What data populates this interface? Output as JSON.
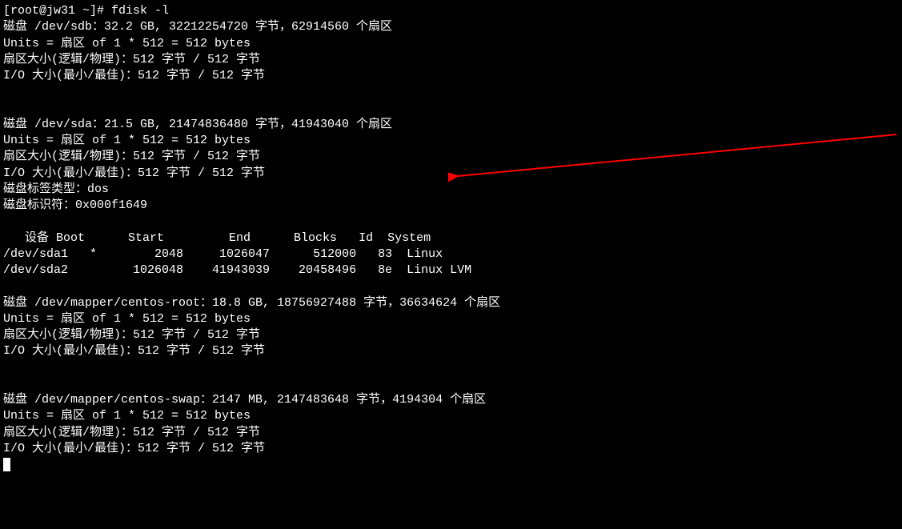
{
  "prompt": "[root@jw31 ~]# ",
  "command": "fdisk -l",
  "blank": "",
  "sdb": {
    "l1": "磁盘 /dev/sdb：32.2 GB, 32212254720 字节，62914560 个扇区",
    "l2": "Units = 扇区 of 1 * 512 = 512 bytes",
    "l3": "扇区大小(逻辑/物理)：512 字节 / 512 字节",
    "l4": "I/O 大小(最小/最佳)：512 字节 / 512 字节"
  },
  "sda": {
    "l1": "磁盘 /dev/sda：21.5 GB, 21474836480 字节，41943040 个扇区",
    "l2": "Units = 扇区 of 1 * 512 = 512 bytes",
    "l3": "扇区大小(逻辑/物理)：512 字节 / 512 字节",
    "l4": "I/O 大小(最小/最佳)：512 字节 / 512 字节",
    "l5": "磁盘标签类型：dos",
    "l6": "磁盘标识符：0x000f1649"
  },
  "table": {
    "header": "   设备 Boot      Start         End      Blocks   Id  System",
    "row1": "/dev/sda1   *        2048     1026047      512000   83  Linux",
    "row2": "/dev/sda2         1026048    41943039    20458496   8e  Linux LVM"
  },
  "root": {
    "l1": "磁盘 /dev/mapper/centos-root：18.8 GB, 18756927488 字节，36634624 个扇区",
    "l2": "Units = 扇区 of 1 * 512 = 512 bytes",
    "l3": "扇区大小(逻辑/物理)：512 字节 / 512 字节",
    "l4": "I/O 大小(最小/最佳)：512 字节 / 512 字节"
  },
  "swap": {
    "l1": "磁盘 /dev/mapper/centos-swap：2147 MB, 2147483648 字节，4194304 个扇区",
    "l2": "Units = 扇区 of 1 * 512 = 512 bytes",
    "l3": "扇区大小(逻辑/物理)：512 字节 / 512 字节",
    "l4": "I/O 大小(最小/最佳)：512 字节 / 512 字节"
  },
  "arrow_color": "#ff0000"
}
